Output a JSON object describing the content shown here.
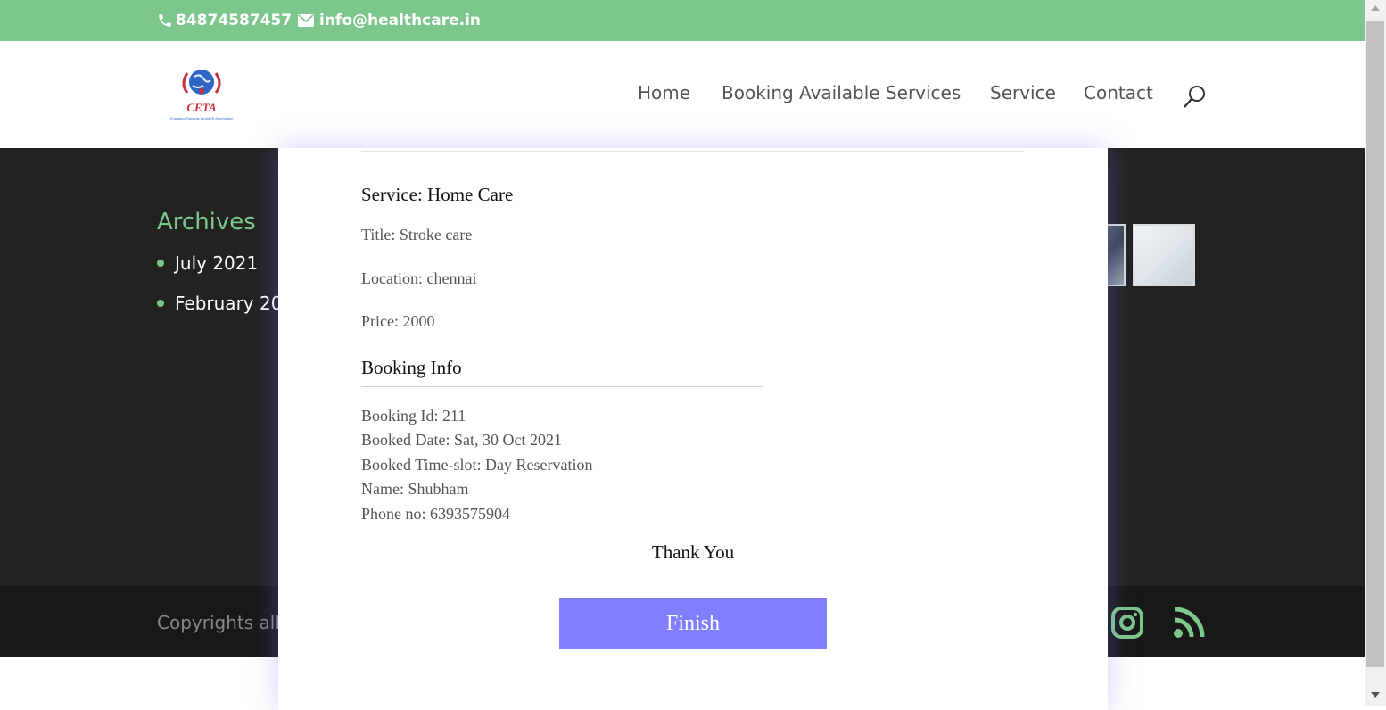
{
  "topbar": {
    "phone": "84874587457",
    "email": "info@healthcare.in",
    "background": "#7dc68c"
  },
  "header": {
    "logo_text": "CETA",
    "logo_tagline": "Changing Towards World Of Automation",
    "nav": [
      "Home",
      "Booking Available Services",
      "Service",
      "Contact"
    ],
    "search_icon": "search-icon"
  },
  "sidebar": {
    "archives_title": "Archives",
    "archives": [
      "July 2021",
      "February 20"
    ]
  },
  "footer": {
    "copyright": "Copyrights all",
    "social": [
      "instagram-icon",
      "rss-icon"
    ],
    "accent": "#7dc68c"
  },
  "modal": {
    "service": "Service: Home Care",
    "title": "Title: Stroke care",
    "location": "Location: chennai",
    "price": "Price: 2000",
    "booking_heading": "Booking Info",
    "booking_id": "Booking Id: 211",
    "booked_date": "Booked Date: Sat, 30 Oct 2021",
    "booked_time_slot": "Booked Time-slot: Day Reservation",
    "name": "Name: Shubham",
    "phone": "Phone no: 6393575904",
    "thanks": "Thank You",
    "finish_label": "Finish",
    "finish_color": "#8080ff"
  }
}
